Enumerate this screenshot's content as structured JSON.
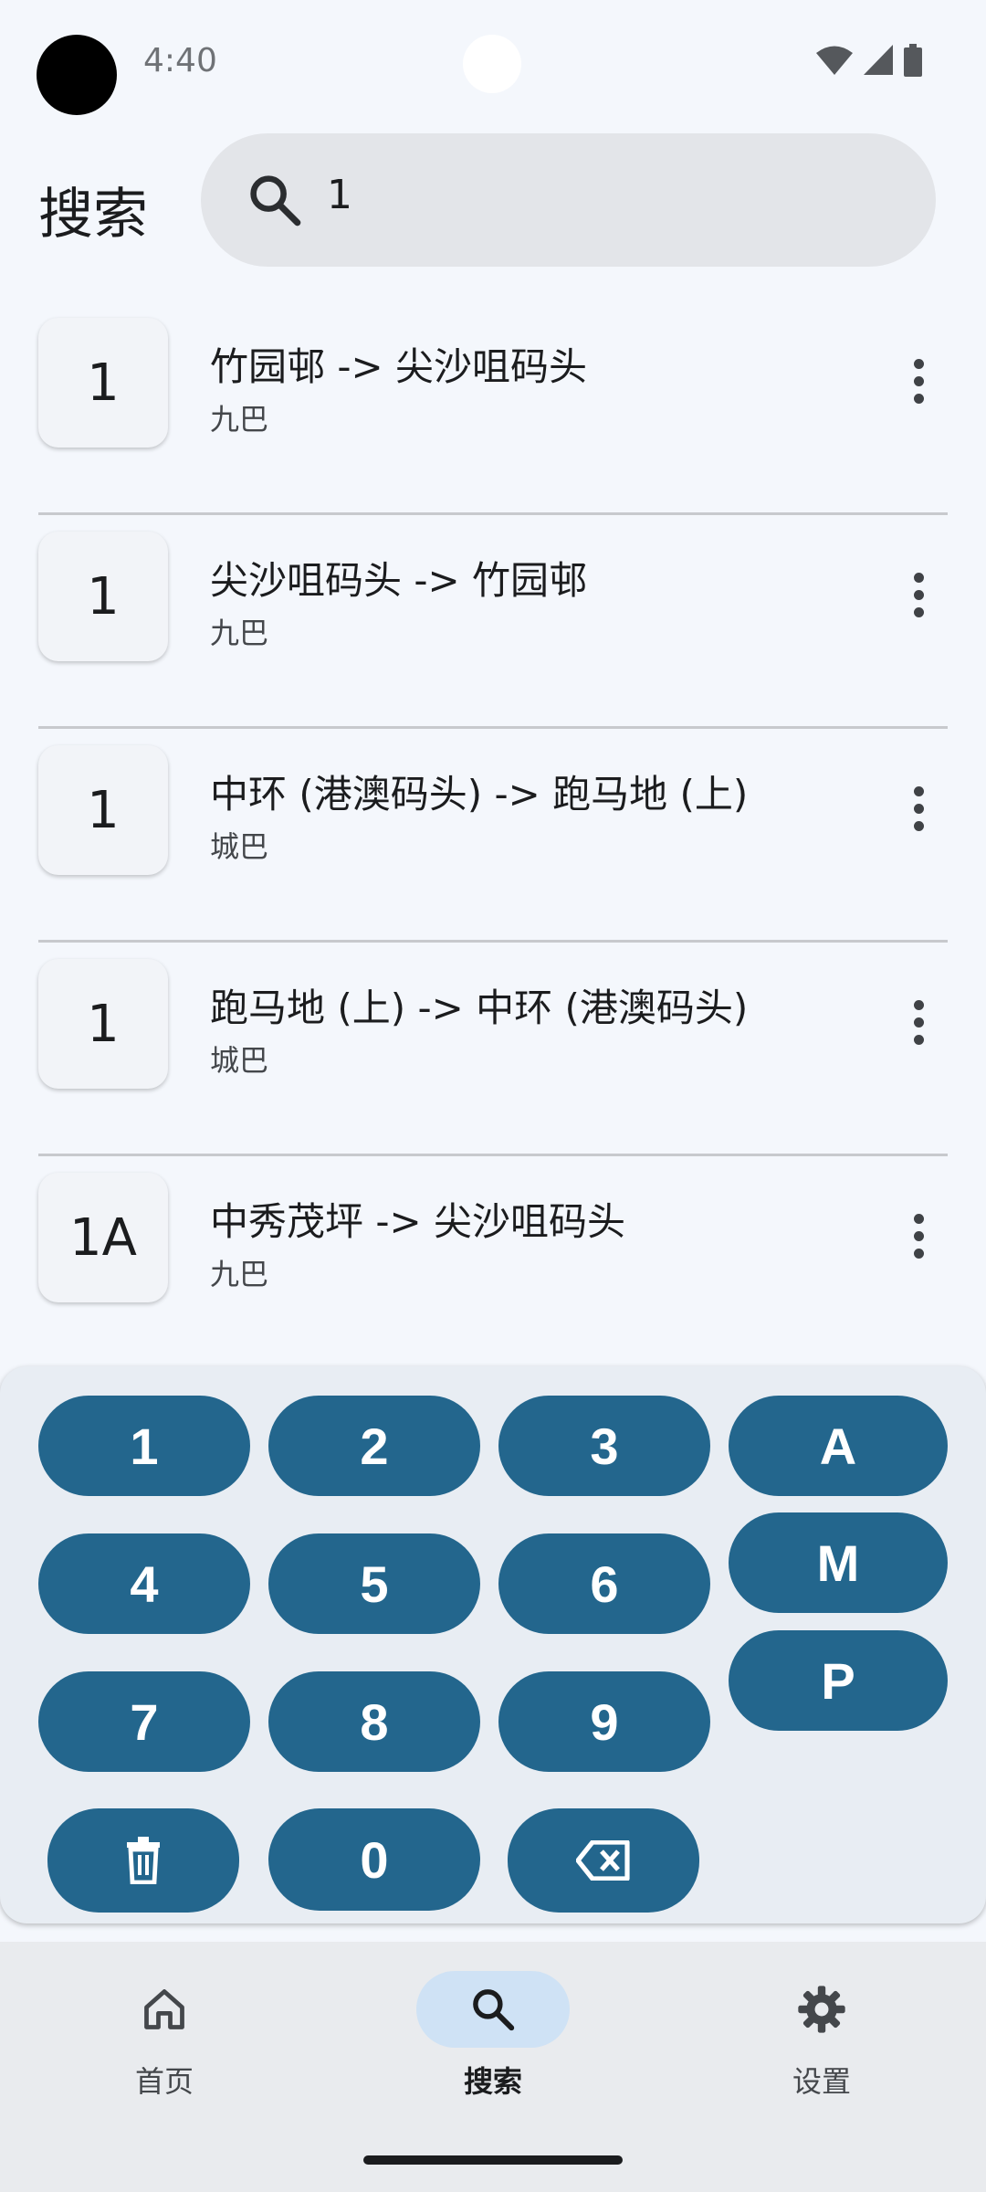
{
  "status_bar": {
    "time": "4:40"
  },
  "header": {
    "title": "搜索",
    "search_value": "1"
  },
  "results": [
    {
      "route": "1",
      "destination": "竹园邨 -> 尖沙咀码头",
      "company": "九巴"
    },
    {
      "route": "1",
      "destination": "尖沙咀码头 -> 竹园邨",
      "company": "九巴"
    },
    {
      "route": "1",
      "destination": "中环 (港澳码头) -> 跑马地 (上)",
      "company": "城巴"
    },
    {
      "route": "1",
      "destination": "跑马地 (上) -> 中环 (港澳码头)",
      "company": "城巴"
    },
    {
      "route": "1A",
      "destination": "中秀茂坪 -> 尖沙咀码头",
      "company": "九巴"
    }
  ],
  "keypad": {
    "digits": [
      "1",
      "2",
      "3",
      "4",
      "5",
      "6",
      "7",
      "8",
      "9",
      "0"
    ],
    "letters": [
      "A",
      "M",
      "P"
    ],
    "clear_icon": "trash-icon",
    "backspace_icon": "backspace-icon",
    "key_color": "#23668d"
  },
  "bottom_nav": {
    "items": [
      {
        "label": "首页",
        "icon": "home-icon",
        "active": false
      },
      {
        "label": "搜索",
        "icon": "search-icon",
        "active": true
      },
      {
        "label": "设置",
        "icon": "gear-icon",
        "active": false
      }
    ]
  }
}
